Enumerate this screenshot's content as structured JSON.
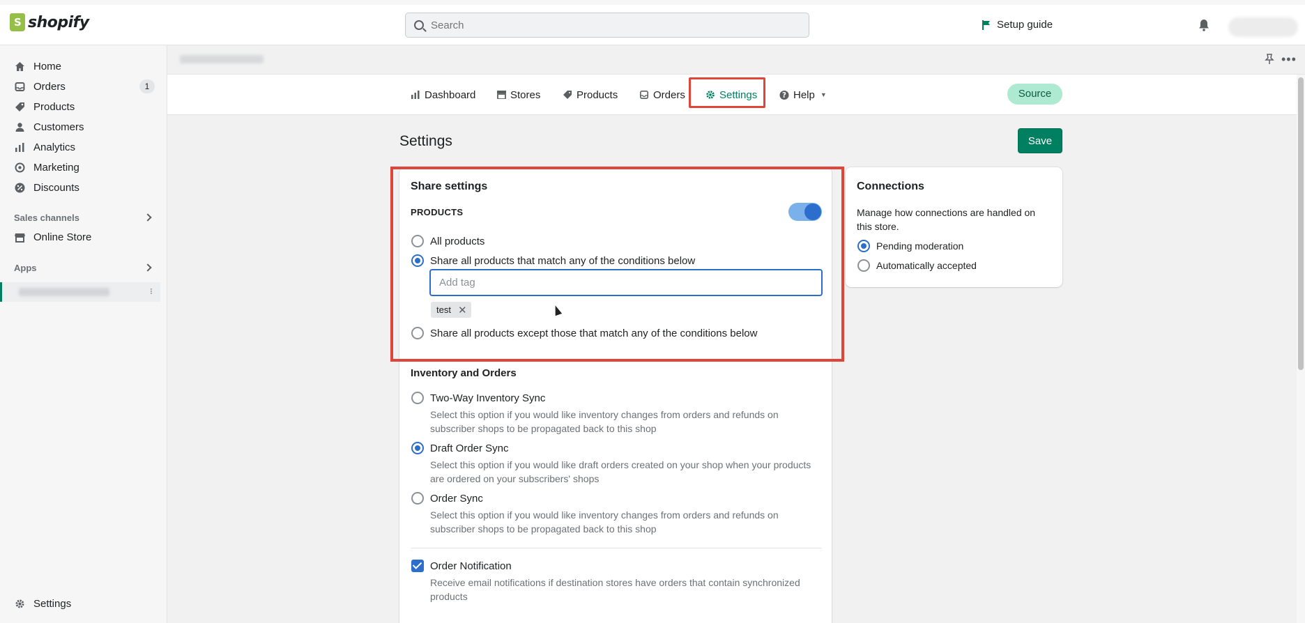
{
  "topbar": {
    "logo_text": "shopify",
    "search_placeholder": "Search",
    "setup_guide": "Setup guide"
  },
  "sidebar": {
    "items": [
      {
        "label": "Home",
        "icon": "home-icon"
      },
      {
        "label": "Orders",
        "icon": "orders-icon",
        "badge": "1"
      },
      {
        "label": "Products",
        "icon": "tag-icon"
      },
      {
        "label": "Customers",
        "icon": "person-icon"
      },
      {
        "label": "Analytics",
        "icon": "bar-chart-icon"
      },
      {
        "label": "Marketing",
        "icon": "target-icon"
      },
      {
        "label": "Discounts",
        "icon": "discount-icon"
      }
    ],
    "sales_channels_title": "Sales channels",
    "online_store": "Online Store",
    "apps_title": "Apps",
    "settings": "Settings"
  },
  "appnav": {
    "tabs": [
      {
        "label": "Dashboard",
        "icon": "bar-chart-icon"
      },
      {
        "label": "Stores",
        "icon": "store-icon"
      },
      {
        "label": "Products",
        "icon": "tag-icon"
      },
      {
        "label": "Orders",
        "icon": "inbox-icon"
      },
      {
        "label": "Settings",
        "icon": "gear-icon",
        "active": true
      },
      {
        "label": "Help",
        "icon": "question-icon"
      }
    ],
    "source": "Source"
  },
  "page": {
    "title": "Settings",
    "save": "Save"
  },
  "share": {
    "title": "Share settings",
    "products_heading": "PRODUCTS",
    "toggle_on": true,
    "option_all": "All products",
    "option_match": "Share all products that match any of the conditions below",
    "tag_placeholder": "Add tag",
    "tag": "test",
    "option_except": "Share all products except those that match any of the conditions below",
    "selected": "option_match"
  },
  "inventory": {
    "title": "Inventory and Orders",
    "two_way_label": "Two-Way Inventory Sync",
    "two_way_desc": "Select this option if you would like inventory changes from orders and refunds on subscriber shops to be propagated back to this shop",
    "draft_label": "Draft Order Sync",
    "draft_desc": "Select this option if you would like draft orders created on your shop when your products are ordered on your subscribers' shops",
    "order_label": "Order Sync",
    "order_desc": "Select this option if you would like inventory changes from orders and refunds on subscriber shops to be propagated back to this shop",
    "selected": "draft",
    "notification_label": "Order Notification",
    "notification_desc": "Receive email notifications if destination stores have orders that contain synchronized products",
    "notification_checked": true
  },
  "connections": {
    "title": "Connections",
    "description": "Manage how connections are handled on this store.",
    "pending": "Pending moderation",
    "auto": "Automatically accepted",
    "selected": "pending"
  },
  "colors": {
    "accent": "#008060",
    "highlight": "#e0453a",
    "selection": "#2c6ecb"
  }
}
